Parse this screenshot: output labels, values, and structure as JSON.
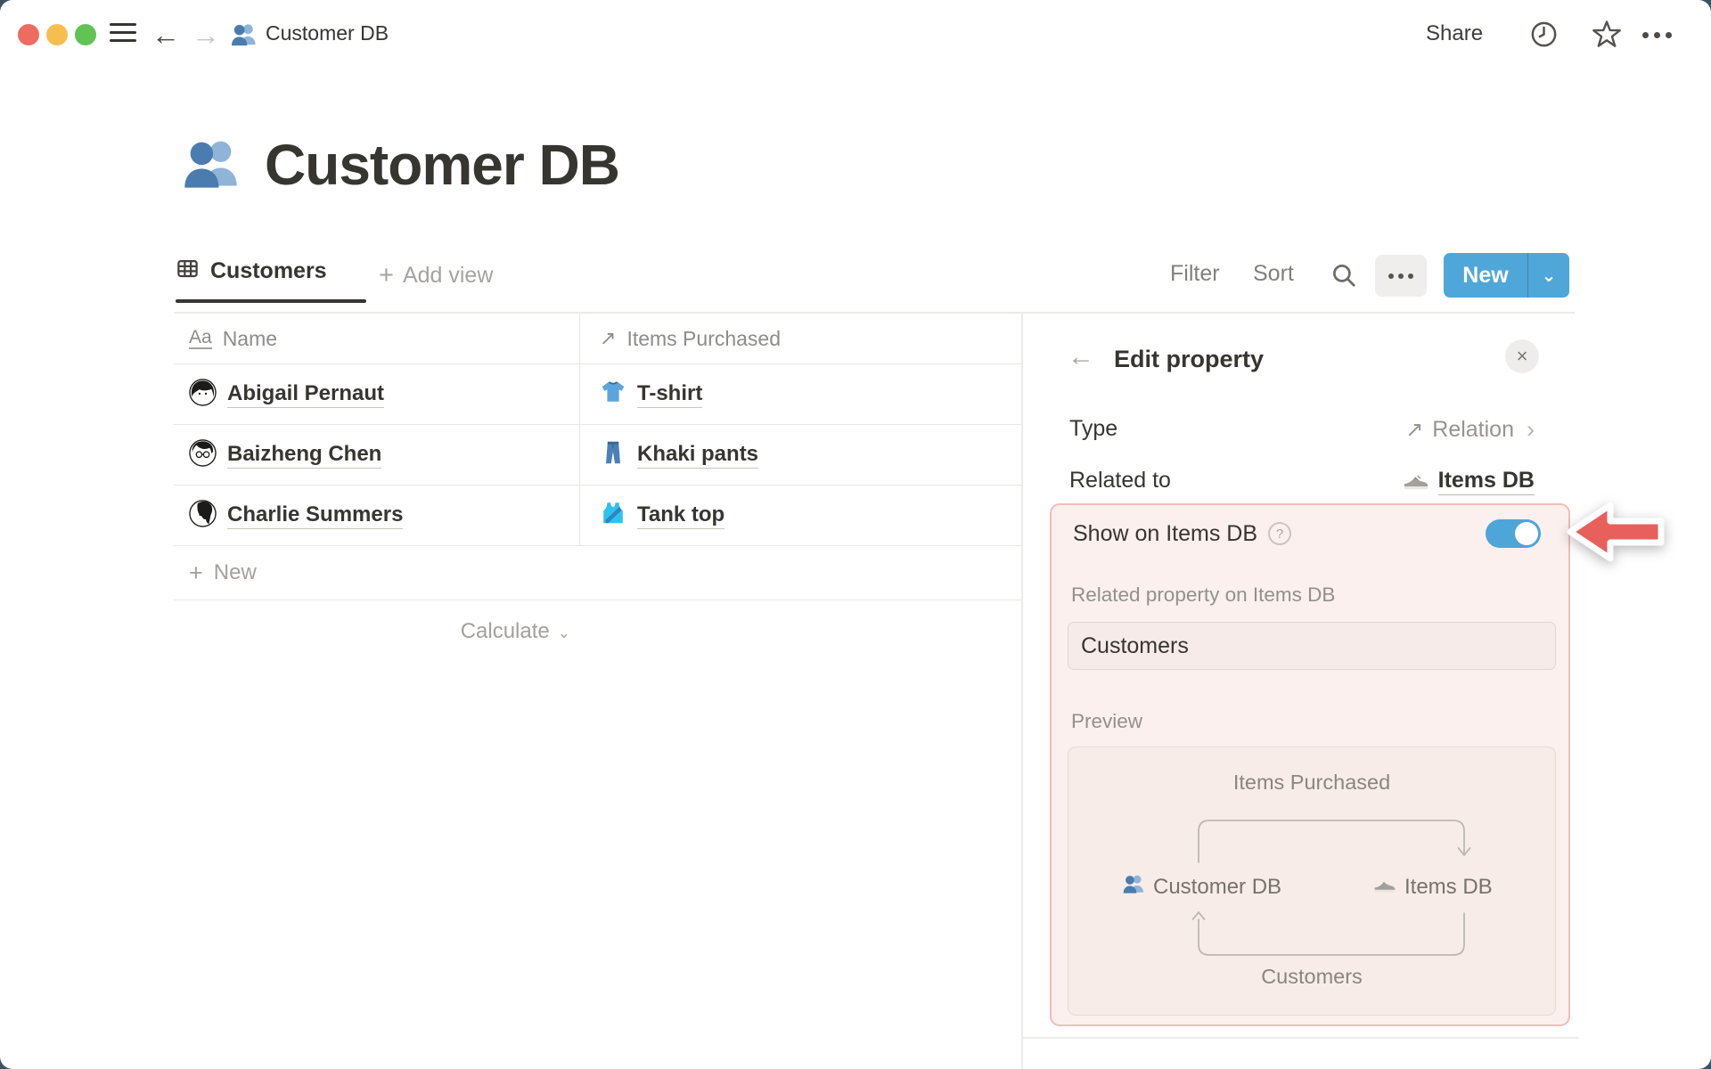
{
  "titlebar": {
    "doc_title": "Customer DB",
    "share_label": "Share"
  },
  "glyphs": {
    "back_arrow": "←",
    "forward_arrow": "→",
    "plus": "+",
    "relation_arrow": "↗",
    "chevron_down": "⌄",
    "chevron_right": "›",
    "close": "×",
    "question": "?",
    "text_type": "Aa"
  },
  "page": {
    "title": "Customer DB",
    "title_icon": "people-icon"
  },
  "toolbar": {
    "tab_label": "Customers",
    "add_view_label": "Add view",
    "filter_label": "Filter",
    "sort_label": "Sort",
    "new_label": "New"
  },
  "table": {
    "columns": [
      {
        "icon": "text-type-icon",
        "label": "Name"
      },
      {
        "icon": "relation-arrow-icon",
        "label": "Items Purchased"
      }
    ],
    "rows": [
      {
        "name": "Abigail Pernaut",
        "item": "T-shirt",
        "item_icon": "tshirt-icon"
      },
      {
        "name": "Baizheng Chen",
        "item": "Khaki pants",
        "item_icon": "pants-icon"
      },
      {
        "name": "Charlie Summers",
        "item": "Tank top",
        "item_icon": "tanktop-icon"
      }
    ],
    "new_row_label": "New",
    "calculate_label": "Calculate"
  },
  "panel": {
    "title": "Edit property",
    "type_label": "Type",
    "type_value": "Relation",
    "related_to_label": "Related to",
    "related_to_value": "Items DB",
    "related_to_icon": "sneaker-icon",
    "show_on_label": "Show on Items DB",
    "toggle_on": true,
    "related_property_label": "Related property on Items DB",
    "related_property_value": "Customers",
    "preview_label": "Preview",
    "preview": {
      "top_arrow_label": "Items Purchased",
      "left_node_label": "Customer DB",
      "left_node_icon": "people-icon",
      "right_node_label": "Items DB",
      "right_node_icon": "sneaker-icon",
      "bottom_arrow_label": "Customers"
    }
  },
  "colors": {
    "accent_blue": "#4EA7D8",
    "toggle_blue": "#4DA6D7",
    "highlight_bg": "#FBF0EE",
    "highlight_border": "#F2BDB8",
    "annotation_red": "#E8605C",
    "text_dark": "#37352F"
  }
}
